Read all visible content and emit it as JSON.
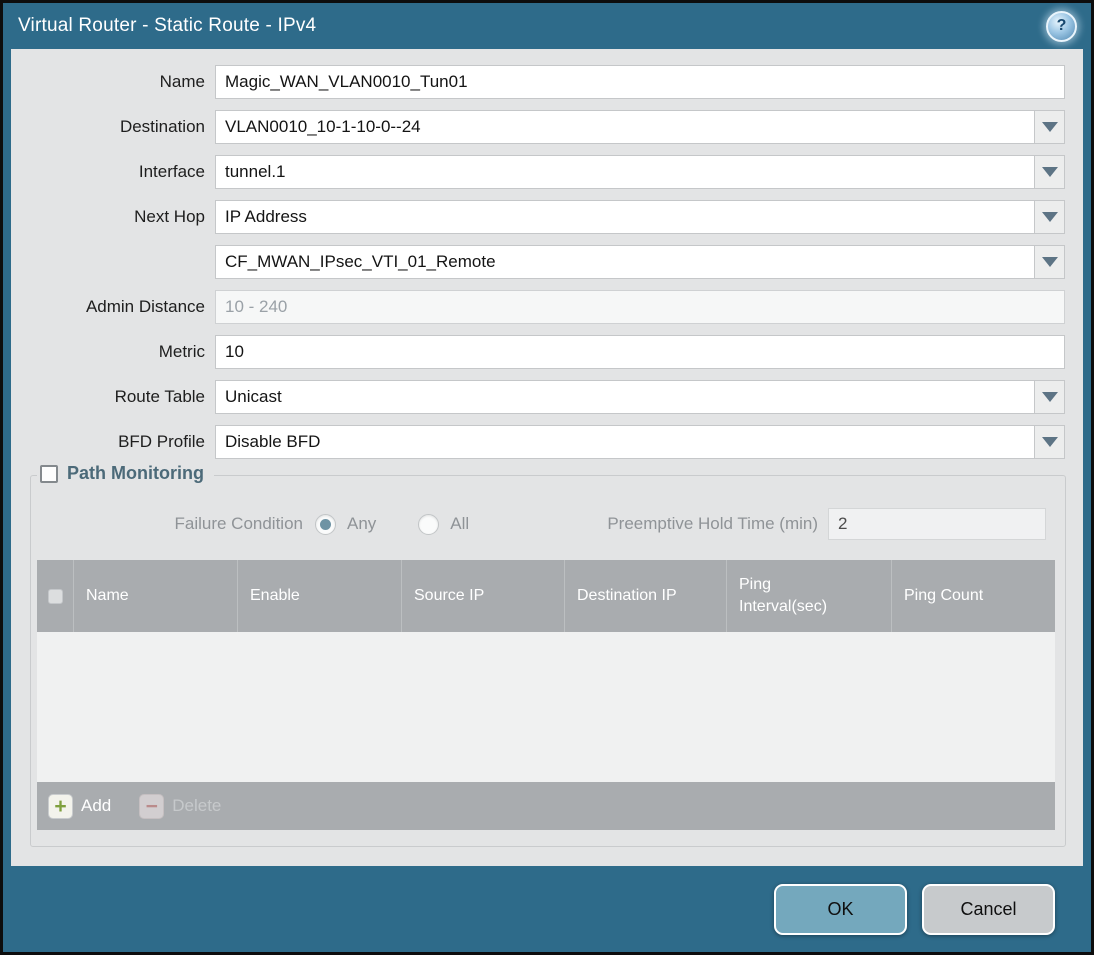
{
  "dialog": {
    "title": "Virtual Router - Static Route - IPv4"
  },
  "icons": {
    "help_glyph": "?",
    "add_glyph": "+",
    "delete_glyph": "−"
  },
  "colors": {
    "titlebar_teal": "#2e6b8a",
    "panel_bg": "#e3e4e5",
    "table_header_gray": "#a9acaf",
    "ok_button": "#74a8bd",
    "cancel_button": "#c7cacc",
    "section_title": "#4c6a79",
    "add_icon_green": "#7fa03e",
    "delete_icon_red": "#c08080"
  },
  "form": {
    "fields": [
      {
        "label": "Name",
        "value": "Magic_WAN_VLAN0010_Tun01"
      },
      {
        "label": "Destination",
        "value": "VLAN0010_10-1-10-0--24"
      },
      {
        "label": "Interface",
        "value": "tunnel.1"
      },
      {
        "label": "Next Hop",
        "value": "IP Address"
      },
      {
        "label": "",
        "value": "CF_MWAN_IPsec_VTI_01_Remote"
      },
      {
        "label": "Admin Distance",
        "value": "",
        "placeholder": "10 - 240"
      },
      {
        "label": "Metric",
        "value": "10"
      },
      {
        "label": "Route Table",
        "value": "Unicast"
      },
      {
        "label": "BFD Profile",
        "value": "Disable BFD"
      }
    ]
  },
  "path_monitoring": {
    "title": "Path Monitoring",
    "checkbox_checked": false,
    "failure_condition": {
      "label": "Failure Condition",
      "options": [
        "Any",
        "All"
      ],
      "selected": "Any"
    },
    "preemptive_hold_time": {
      "label": "Preemptive Hold Time (min)",
      "value": "2"
    },
    "table": {
      "columns": [
        "Name",
        "Enable",
        "Source IP",
        "Destination IP",
        "Ping Interval(sec)",
        "Ping Count"
      ],
      "rows": []
    },
    "actions": {
      "add_label": "Add",
      "delete_label": "Delete"
    }
  },
  "footer": {
    "ok_label": "OK",
    "cancel_label": "Cancel"
  }
}
